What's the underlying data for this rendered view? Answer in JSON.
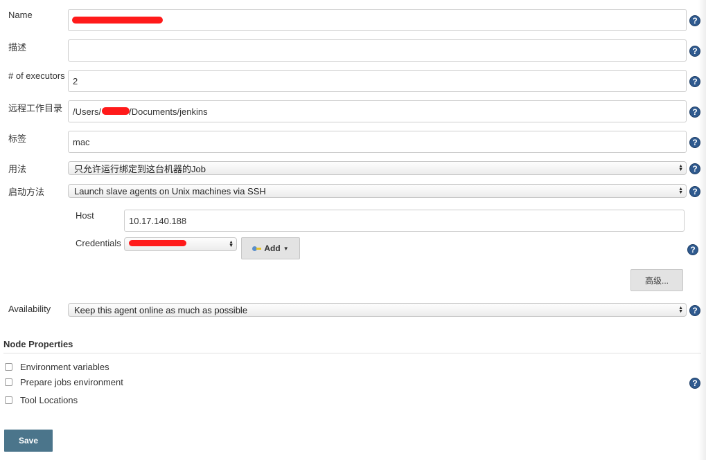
{
  "fields": {
    "name": {
      "label": "Name",
      "value": ""
    },
    "description": {
      "label": "描述",
      "value": ""
    },
    "executors": {
      "label": "# of executors",
      "value": "2"
    },
    "remote_dir": {
      "label": "远程工作目录",
      "value_prefix": "/Users/",
      "value_suffix": "/Documents/jenkins"
    },
    "labels": {
      "label": "标签",
      "value": "mac"
    },
    "usage": {
      "label": "用法",
      "selected": "只允许运行绑定到这台机器的Job"
    },
    "launch_method": {
      "label": "启动方法",
      "selected": "Launch slave agents on Unix machines via SSH"
    },
    "host": {
      "label": "Host",
      "value": "10.17.140.188"
    },
    "credentials": {
      "label": "Credentials",
      "selected": ""
    },
    "availability": {
      "label": "Availability",
      "selected": "Keep this agent online as much as possible"
    }
  },
  "buttons": {
    "add": "Add",
    "advanced": "高级...",
    "save": "Save"
  },
  "help_glyph": "?",
  "node_properties": {
    "title": "Node Properties",
    "items": [
      {
        "label": "Environment variables",
        "checked": false
      },
      {
        "label": "Prepare jobs environment",
        "checked": false
      },
      {
        "label": "Tool Locations",
        "checked": false
      }
    ]
  },
  "colors": {
    "help_icon": "#2f5a8f",
    "save_button": "#4b758b",
    "redaction": "#ff1a1a"
  },
  "icons": {
    "help": "question-circle-icon",
    "select_arrows": "up-down-arrows-icon",
    "key": "key-icon",
    "dropdown_caret": "caret-down-icon"
  }
}
